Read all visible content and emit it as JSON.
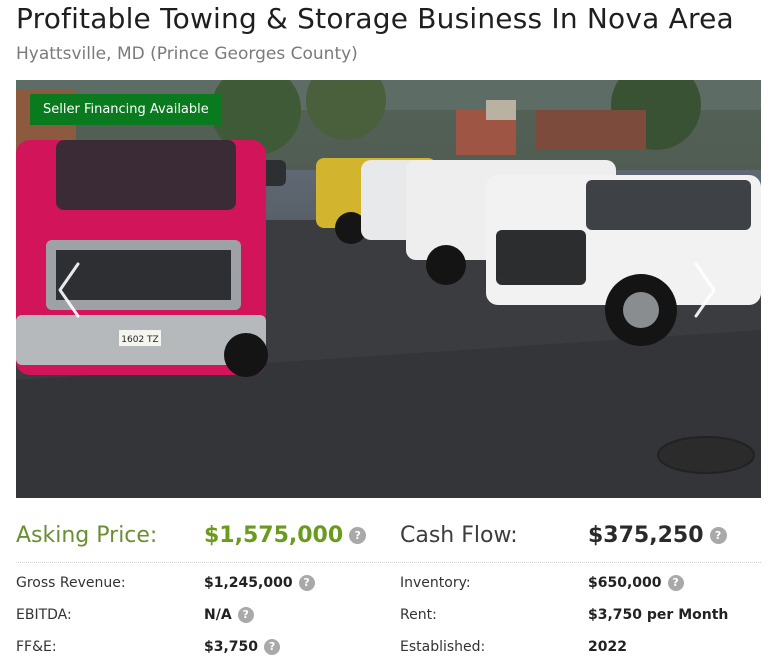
{
  "listing": {
    "title": "Profitable Towing & Storage Business In Nova Area",
    "location": "Hyattsville, MD (Prince Georges County)"
  },
  "gallery": {
    "badge": "Seller Financing Available",
    "plate": "1602 TZ"
  },
  "financials": {
    "asking_price": {
      "label": "Asking Price:",
      "value": "$1,575,000"
    },
    "cash_flow": {
      "label": "Cash Flow:",
      "value": "$375,250"
    },
    "gross_revenue": {
      "label": "Gross Revenue:",
      "value": "$1,245,000"
    },
    "inventory": {
      "label": "Inventory:",
      "value": "$650,000"
    },
    "ebitda": {
      "label": "EBITDA:",
      "value": "N/A"
    },
    "rent": {
      "label": "Rent:",
      "value": "$3,750 per Month"
    },
    "ffe": {
      "label": "FF&E:",
      "value": "$3,750"
    },
    "established": {
      "label": "Established:",
      "value": "2022"
    }
  },
  "colors": {
    "badge_bg": "#0a7a1e",
    "price_green": "#6a9a1e"
  },
  "icons": {
    "help": "?",
    "prev": "chevron-left-icon",
    "next": "chevron-right-icon"
  }
}
